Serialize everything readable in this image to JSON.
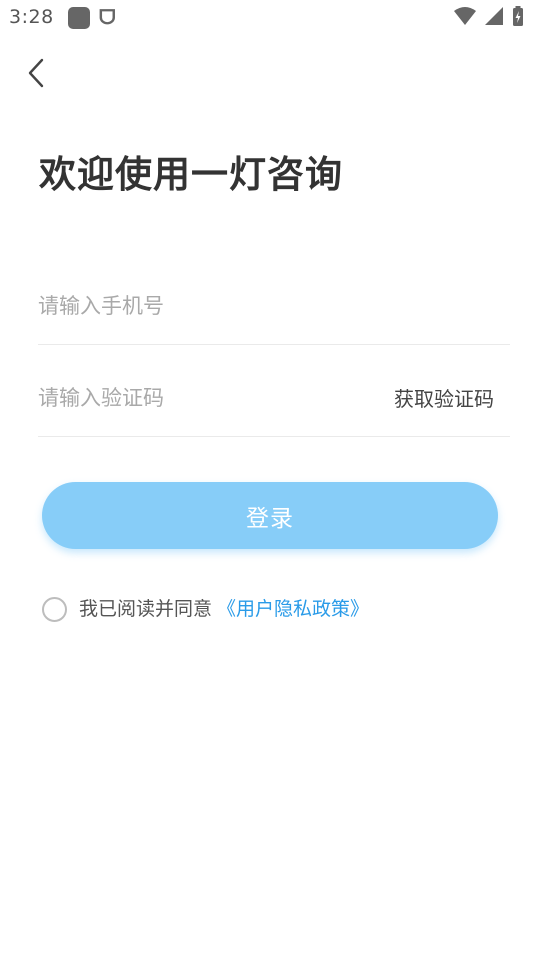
{
  "status_bar": {
    "time": "3:28",
    "app_icons": [
      "app-square-icon",
      "bug-icon"
    ],
    "right_icons": [
      "wifi-icon",
      "signal-icon",
      "battery-charging-icon"
    ]
  },
  "nav": {
    "back_icon": "chevron-left-icon"
  },
  "title": "欢迎使用一灯咨询",
  "phone_input": {
    "placeholder": "请输入手机号",
    "value": ""
  },
  "code_input": {
    "placeholder": "请输入验证码",
    "value": ""
  },
  "get_code_label": "获取验证码",
  "login_label": "登录",
  "agreement": {
    "text": "我已阅读并同意",
    "link": "《用户隐私政策》",
    "checked": false
  },
  "colors": {
    "primary_button": "#87cdf8",
    "link": "#2a9be8",
    "title": "#333333",
    "placeholder": "#a9a9a9"
  }
}
